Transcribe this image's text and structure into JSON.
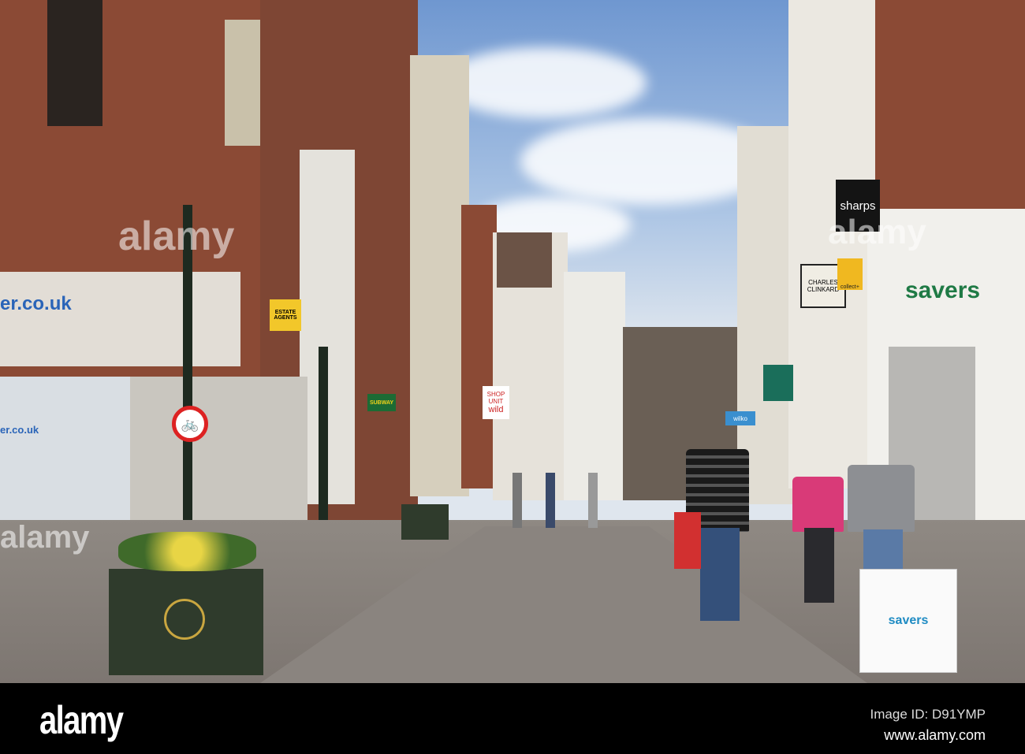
{
  "signs": {
    "estate_agents": "ESTATE AGENTS",
    "shop_unit": "SHOP UNIT",
    "wild": "wild",
    "subway": "SUBWAY",
    "sharps": "sharps",
    "charles_clinkard": "CHARLES CLINKARD",
    "collect": "collect+",
    "savers_storefront": "savers",
    "savers_board": "savers",
    "left_shop_top": "er.co.uk",
    "left_shop_window": "er.co.uk",
    "wilkos": "wilko"
  },
  "watermark": {
    "logo": "alamy",
    "image_id": "Image ID: D91YMP",
    "website": "www.alamy.com"
  },
  "colors": {
    "brick": "#8b4a35",
    "savers_green": "#1f7a45",
    "sky": "#a9c3e4"
  }
}
